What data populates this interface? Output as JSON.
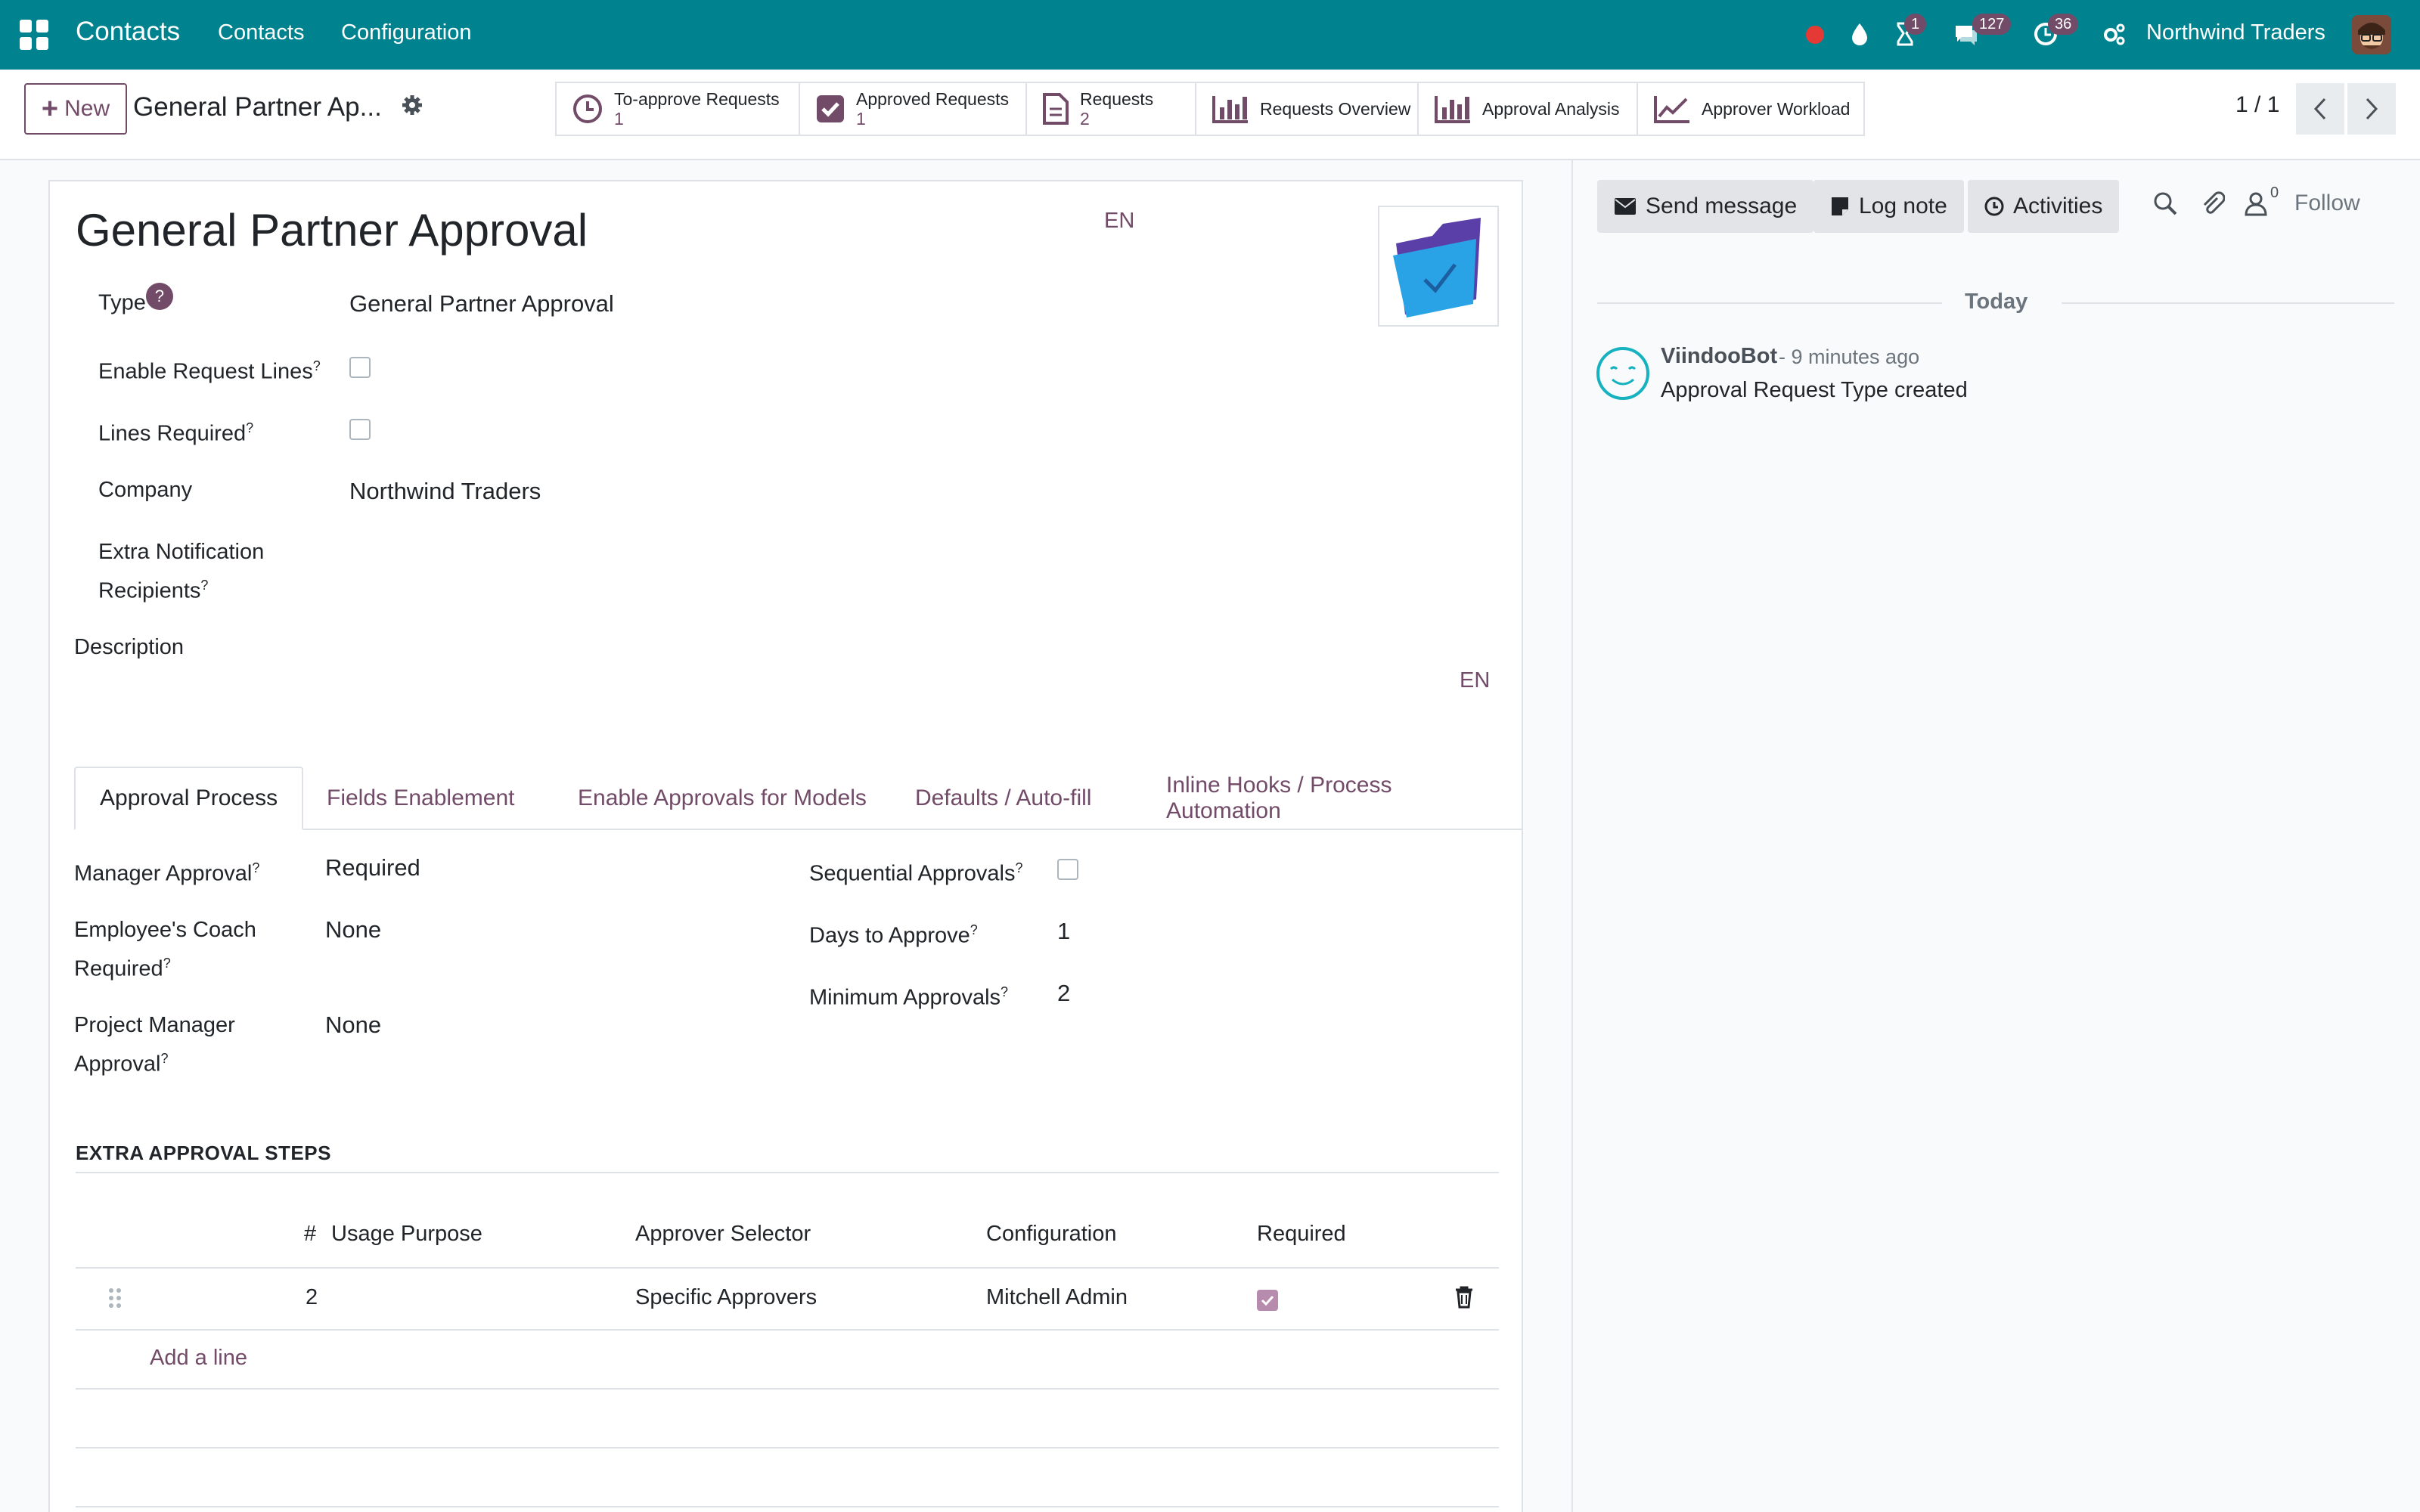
{
  "navbar": {
    "app_name": "Contacts",
    "menu": [
      "Contacts",
      "Configuration"
    ],
    "badges": {
      "activity": "1",
      "messages": "127",
      "clock": "36"
    },
    "company": "Northwind Traders",
    "colors": {
      "bar": "#00838f",
      "badge": "#714b67",
      "record_dot": "#e53935"
    }
  },
  "control": {
    "new_label": "New",
    "record_name": "General Partner Ap...",
    "smart_buttons": [
      {
        "label": "To-approve Requests",
        "count": "1",
        "icon": "clock-icon"
      },
      {
        "label": "Approved Requests",
        "count": "1",
        "icon": "check-square-icon"
      },
      {
        "label": "Requests",
        "count": "2",
        "icon": "document-icon"
      },
      {
        "label": "Requests Overview",
        "icon": "bar-chart-icon"
      },
      {
        "label": "Approval Analysis",
        "icon": "bar-chart-icon"
      },
      {
        "label": "Approver Workload",
        "icon": "line-chart-icon"
      }
    ],
    "pager": "1 / 1"
  },
  "form": {
    "title": "General Partner Approval",
    "title_lang": "EN",
    "fields": {
      "type_label": "Type",
      "type_help": "?",
      "type_value": "General Partner Approval",
      "enable_lines_label": "Enable Request Lines",
      "lines_required_label": "Lines Required",
      "company_label": "Company",
      "company_value": "Northwind Traders",
      "extra_recipients_label_1": "Extra Notification",
      "extra_recipients_label_2": "Recipients",
      "description_label": "Description",
      "description_lang": "EN",
      "help_mark": "?"
    },
    "tabs": [
      "Approval Process",
      "Fields Enablement",
      "Enable Approvals for Models",
      "Defaults / Auto-fill",
      "Inline Hooks / Process Automation"
    ],
    "approval_process": {
      "manager_label": "Manager Approval",
      "manager_value": "Required",
      "coach_label_1": "Employee's Coach",
      "coach_label_2": "Required",
      "coach_value": "None",
      "pm_label_1": "Project Manager",
      "pm_label_2": "Approval",
      "pm_value": "None",
      "sequential_label": "Sequential Approvals",
      "days_label": "Days to Approve",
      "days_value": "1",
      "min_label": "Minimum Approvals",
      "min_value": "2"
    },
    "extra_steps": {
      "title": "EXTRA APPROVAL STEPS",
      "columns": [
        "#",
        "Usage Purpose",
        "Approver Selector",
        "Configuration",
        "Required"
      ],
      "rows": [
        {
          "number": "2",
          "usage_purpose": "",
          "approver_selector": "Specific Approvers",
          "configuration": "Mitchell Admin",
          "required": true
        }
      ],
      "add_line": "Add a line"
    }
  },
  "chatter": {
    "send_message": "Send message",
    "log_note": "Log note",
    "activities": "Activities",
    "followers_count": "0",
    "follow": "Follow",
    "today": "Today",
    "messages": [
      {
        "author": "ViindooBot",
        "time": "- 9 minutes ago",
        "body": "Approval Request Type created"
      }
    ]
  }
}
